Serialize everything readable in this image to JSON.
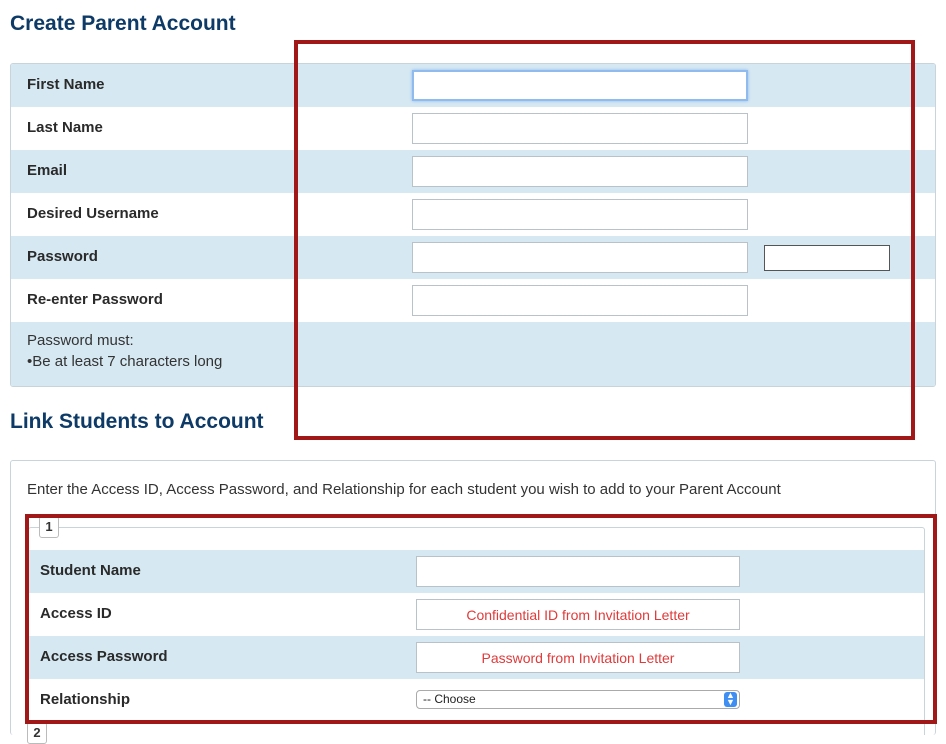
{
  "create": {
    "title": "Create Parent Account",
    "fields": [
      {
        "label": "First Name"
      },
      {
        "label": "Last Name"
      },
      {
        "label": "Email"
      },
      {
        "label": "Desired Username"
      },
      {
        "label": "Password"
      },
      {
        "label": "Re-enter Password"
      }
    ],
    "hint_line1": "Password must:",
    "hint_line2": "•Be at least 7 characters long"
  },
  "link": {
    "title": "Link Students to Account",
    "intro": "Enter the Access ID, Access Password, and Relationship for each student you wish to add to your Parent Account",
    "group1_number": "1",
    "group2_number": "2",
    "student_name_label": "Student Name",
    "access_id_label": "Access ID",
    "access_id_placeholder": "Confidential ID from Invitation Letter",
    "access_password_label": "Access Password",
    "access_password_placeholder": "Password from Invitation Letter",
    "relationship_label": "Relationship",
    "relationship_selected": "-- Choose"
  },
  "colors": {
    "row_alt": "#d6e8f2",
    "title": "#0d3a66",
    "highlight_box": "#a01818",
    "placeholder": "#e03a3a"
  }
}
